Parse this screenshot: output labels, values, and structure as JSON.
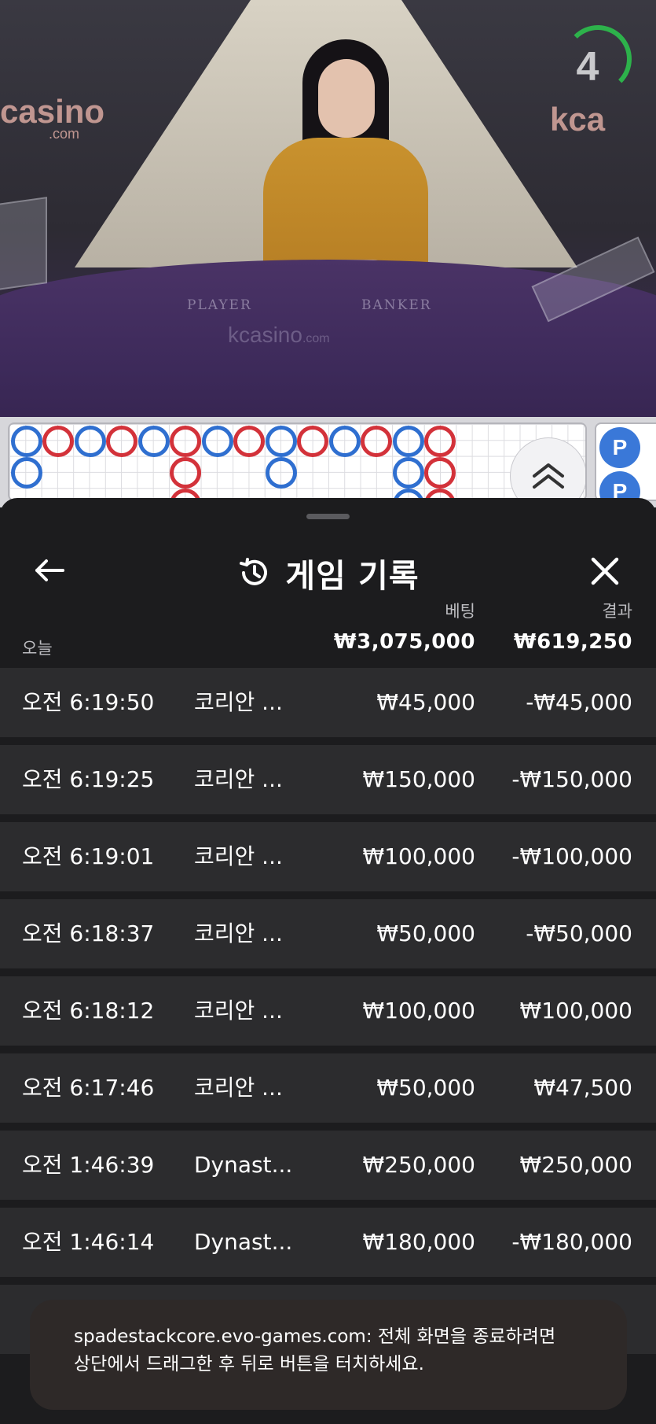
{
  "video": {
    "countdown": "4",
    "brand_left": "casino",
    "brand_left_sub": ".com",
    "brand_right": "kca",
    "table_player_label": "PLAYER",
    "table_banker_label": "BANKER",
    "table_brand": "kcasino",
    "table_brand_sub": ".com"
  },
  "roadmap": {
    "side_chip_label": "P"
  },
  "history": {
    "title": "게임 기록",
    "bet_header": "베팅",
    "result_header": "결과",
    "today_label": "오늘",
    "total_bet": "₩3,075,000",
    "total_result": "₩619,250",
    "rows": [
      {
        "time": "오전 6:19:50",
        "game": "코리안 ...",
        "bet": "₩45,000",
        "result": "-₩45,000"
      },
      {
        "time": "오전 6:19:25",
        "game": "코리안 ...",
        "bet": "₩150,000",
        "result": "-₩150,000"
      },
      {
        "time": "오전 6:19:01",
        "game": "코리안 ...",
        "bet": "₩100,000",
        "result": "-₩100,000"
      },
      {
        "time": "오전 6:18:37",
        "game": "코리안 ...",
        "bet": "₩50,000",
        "result": "-₩50,000"
      },
      {
        "time": "오전 6:18:12",
        "game": "코리안 ...",
        "bet": "₩100,000",
        "result": "₩100,000"
      },
      {
        "time": "오전 6:17:46",
        "game": "코리안 ...",
        "bet": "₩50,000",
        "result": "₩47,500"
      },
      {
        "time": "오전 1:46:39",
        "game": "Dynast...",
        "bet": "₩250,000",
        "result": "₩250,000"
      },
      {
        "time": "오전 1:46:14",
        "game": "Dynast...",
        "bet": "₩180,000",
        "result": "-₩180,000"
      }
    ]
  },
  "toast": {
    "line1": "spadestackcore.evo-games.com: 전체 화면을 종료하려면",
    "line2": "상단에서 드래그한 후 뒤로 버튼을 터치하세요."
  },
  "colors": {
    "player_blue": "#2f6fd0",
    "banker_red": "#d3323a",
    "timer_green": "#2db24b",
    "sheet_bg": "#1c1c1e",
    "row_bg": "#2c2c2e"
  },
  "icons": {
    "back": "arrow-left-icon",
    "history": "history-clock-icon",
    "close": "close-icon",
    "expand": "chevron-double-up-icon"
  }
}
